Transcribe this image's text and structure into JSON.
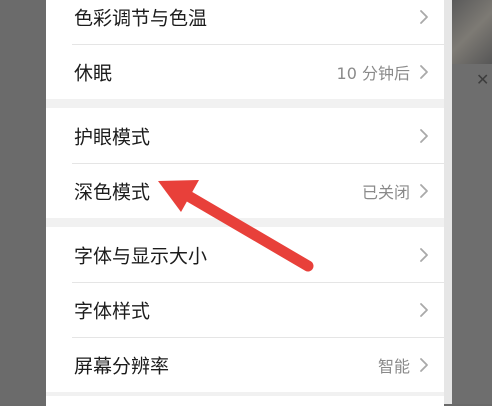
{
  "settings": {
    "group1": [
      {
        "label": "色彩调节与色温",
        "value": ""
      },
      {
        "label": "休眠",
        "value": "10 分钟后"
      }
    ],
    "group2": [
      {
        "label": "护眼模式",
        "value": ""
      },
      {
        "label": "深色模式",
        "value": "已关闭"
      }
    ],
    "group3": [
      {
        "label": "字体与显示大小",
        "value": ""
      },
      {
        "label": "字体样式",
        "value": ""
      },
      {
        "label": "屏幕分辨率",
        "value": "智能"
      }
    ]
  },
  "icons": {
    "row_chevron": "chevron-right-icon",
    "annotation": "red-arrow"
  },
  "colors": {
    "annotation_arrow": "#e8403a",
    "background_overlay": "#6a6a6a",
    "panel": "#f1f1f1"
  }
}
